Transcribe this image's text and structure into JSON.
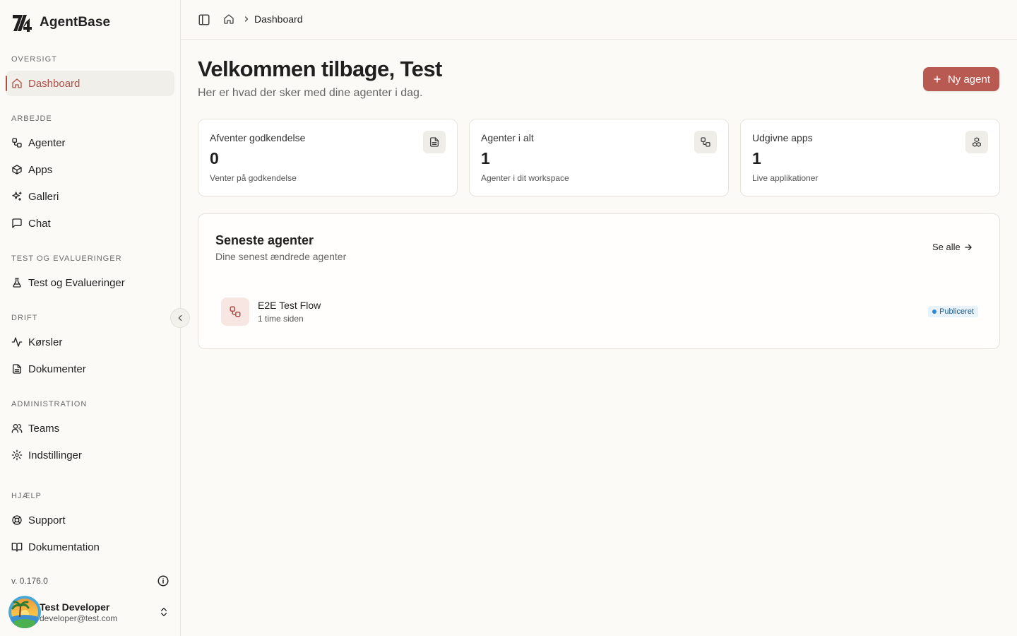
{
  "app": {
    "name": "AgentBase"
  },
  "sidebar": {
    "sections": {
      "overview": "OVERSIGT",
      "work": "ARBEJDE",
      "testing": "TEST OG EVALUERINGER",
      "operations": "DRIFT",
      "administration": "ADMINISTRATION",
      "help": "HJÆLP"
    },
    "items": {
      "dashboard": "Dashboard",
      "agents": "Agenter",
      "apps": "Apps",
      "gallery": "Galleri",
      "chat": "Chat",
      "tests": "Test og Evalueringer",
      "runs": "Kørsler",
      "documents": "Dokumenter",
      "teams": "Teams",
      "settings": "Indstillinger",
      "support": "Support",
      "documentation": "Dokumentation"
    },
    "version": "v. 0.176.0",
    "user": {
      "name": "Test Developer",
      "email": "developer@test.com"
    }
  },
  "breadcrumb": {
    "current": "Dashboard"
  },
  "header": {
    "title": "Velkommen tilbage, Test",
    "subtitle": "Her er hvad der sker med dine agenter i dag.",
    "new_agent_label": "Ny agent"
  },
  "stats": [
    {
      "label": "Afventer godkendelse",
      "value": "0",
      "sub": "Venter på godkendelse",
      "icon": "document-icon"
    },
    {
      "label": "Agenter i alt",
      "value": "1",
      "sub": "Agenter i dit workspace",
      "icon": "workflow-icon"
    },
    {
      "label": "Udgivne apps",
      "value": "1",
      "sub": "Live applikationer",
      "icon": "boxes-icon"
    }
  ],
  "recent": {
    "title": "Seneste agenter",
    "subtitle": "Dine senest ændrede agenter",
    "see_all": "Se alle",
    "agents": [
      {
        "name": "E2E Test Flow",
        "time": "1 time siden",
        "status": "Publiceret"
      }
    ]
  },
  "colors": {
    "accent": "#b95a52",
    "status_published": "#2e86d1"
  }
}
